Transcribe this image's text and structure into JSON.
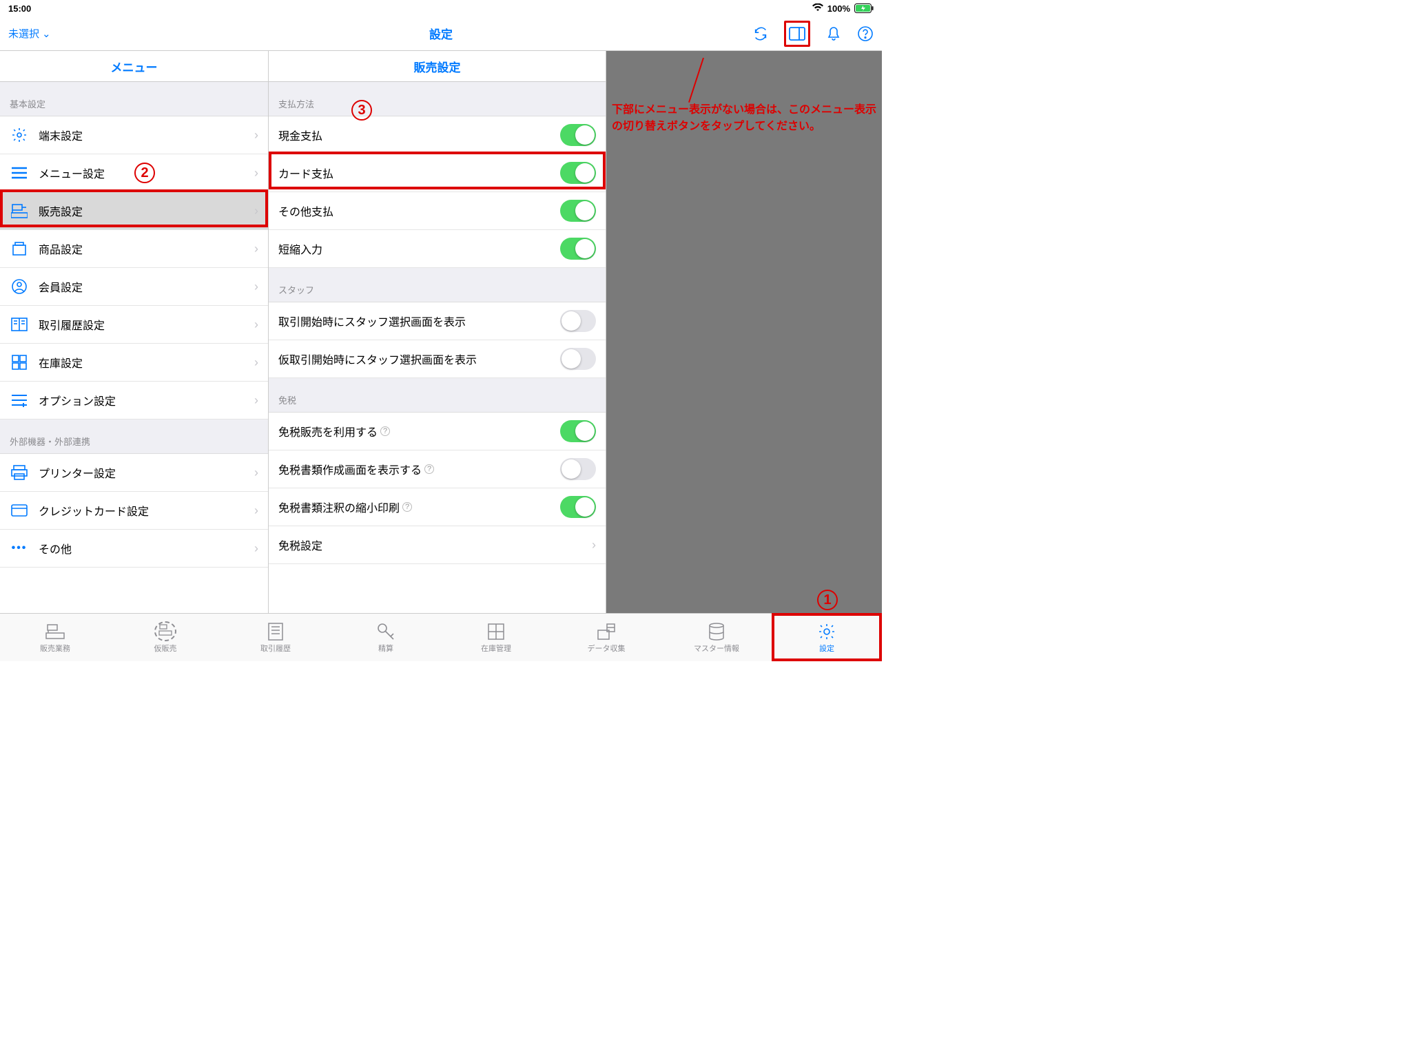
{
  "status": {
    "time": "15:00",
    "wifi": true,
    "battery_pct": "100%"
  },
  "nav": {
    "back_label": "未選択",
    "title": "設定",
    "icons": [
      "refresh",
      "layout",
      "bell",
      "help"
    ]
  },
  "left_panel": {
    "title": "メニュー",
    "sections": [
      {
        "header": "基本設定",
        "rows": [
          {
            "icon": "gear",
            "label": "端末設定"
          },
          {
            "icon": "lines",
            "label": "メニュー設定"
          },
          {
            "icon": "register",
            "label": "販売設定",
            "selected": true
          },
          {
            "icon": "box",
            "label": "商品設定"
          },
          {
            "icon": "person",
            "label": "会員設定"
          },
          {
            "icon": "book",
            "label": "取引履歴設定"
          },
          {
            "icon": "grid",
            "label": "在庫設定"
          },
          {
            "icon": "list-plus",
            "label": "オプション設定"
          }
        ]
      },
      {
        "header": "外部機器・外部連携",
        "rows": [
          {
            "icon": "printer",
            "label": "プリンター設定"
          },
          {
            "icon": "card",
            "label": "クレジットカード設定"
          },
          {
            "icon": "dots",
            "label": "その他"
          }
        ]
      }
    ]
  },
  "detail_panel": {
    "title": "販売設定",
    "groups": [
      {
        "header": "支払方法",
        "rows": [
          {
            "label": "現金支払",
            "toggle": true,
            "on": true
          },
          {
            "label": "カード支払",
            "toggle": true,
            "on": true,
            "highlighted": true
          },
          {
            "label": "その他支払",
            "toggle": true,
            "on": true
          },
          {
            "label": "短縮入力",
            "toggle": true,
            "on": true
          }
        ]
      },
      {
        "header": "スタッフ",
        "rows": [
          {
            "label": "取引開始時にスタッフ選択画面を表示",
            "toggle": true,
            "on": false
          },
          {
            "label": "仮取引開始時にスタッフ選択画面を表示",
            "toggle": true,
            "on": false
          }
        ]
      },
      {
        "header": "免税",
        "rows": [
          {
            "label": "免税販売を利用する",
            "help": true,
            "toggle": true,
            "on": true
          },
          {
            "label": "免税書類作成画面を表示する",
            "help": true,
            "toggle": true,
            "on": false
          },
          {
            "label": "免税書類注釈の縮小印刷",
            "help": true,
            "toggle": true,
            "on": true
          },
          {
            "label": "免税設定",
            "chevron": true
          }
        ]
      }
    ]
  },
  "annotations": {
    "note": "下部にメニュー表示がない場合は、このメニュー表示の切り替えボタンをタップしてください。",
    "badge1": "1",
    "badge2": "2",
    "badge3": "3"
  },
  "tabs": [
    {
      "icon": "register",
      "label": "販売業務"
    },
    {
      "icon": "register-dashed",
      "label": "仮販売"
    },
    {
      "icon": "receipt",
      "label": "取引履歴"
    },
    {
      "icon": "key",
      "label": "精算"
    },
    {
      "icon": "cabinet",
      "label": "在庫管理"
    },
    {
      "icon": "data",
      "label": "データ収集"
    },
    {
      "icon": "database",
      "label": "マスター情報"
    },
    {
      "icon": "gear",
      "label": "設定",
      "active": true
    }
  ]
}
